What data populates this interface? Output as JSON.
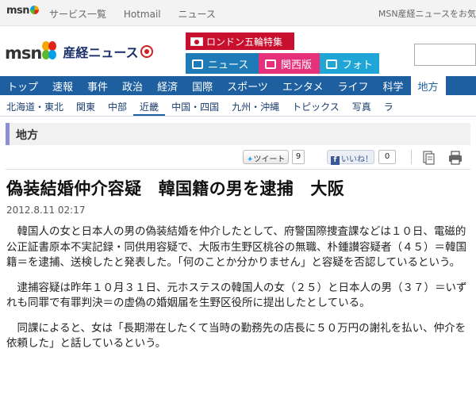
{
  "topbar": {
    "brand": "msn",
    "links": [
      "サービス一覧",
      "Hotmail",
      "ニュース"
    ],
    "right_text": "MSN産経ニュースをお気"
  },
  "header": {
    "logo_msn": "msn",
    "logo_sankei": "産経ニュース",
    "special_label": "ロンドン五輪特集",
    "subtabs": [
      {
        "label": "ニュース",
        "color": "#1e7bb8"
      },
      {
        "label": "関西版",
        "color": "#e5307a"
      },
      {
        "label": "フォト",
        "color": "#1fa6d6"
      }
    ]
  },
  "nav_primary": [
    "トップ",
    "速報",
    "事件",
    "政治",
    "経済",
    "国際",
    "スポーツ",
    "エンタメ",
    "ライフ",
    "科学",
    "地方"
  ],
  "nav_secondary": [
    "北海道・東北",
    "関東",
    "中部",
    "近畿",
    "中国・四国",
    "九州・沖縄",
    "トピックス",
    "写真",
    "ラ"
  ],
  "nav_secondary_active": "近畿",
  "section_title": "地方",
  "share": {
    "tweet_label": "ツイート",
    "tweet_count": "9",
    "like_label": "いいね！",
    "like_count": "0"
  },
  "article": {
    "headline": "偽装結婚仲介容疑　韓国籍の男を逮捕　大阪",
    "date": "2012.8.11 02:17",
    "paragraphs": [
      "韓国人の女と日本人の男の偽装結婚を仲介したとして、府警国際捜査課などは１０日、電磁的公正証書原本不実記録・同供用容疑で、大阪市生野区桃谷の無職、朴鍾讃容疑者（４５）＝韓国籍＝を逮捕、送検したと発表した。「何のことか分かりません」と容疑を否認しているという。",
      "逮捕容疑は昨年１０月３１日、元ホステスの韓国人の女（２５）と日本人の男（３７）＝いずれも同罪で有罪判決＝の虚偽の婚姻届を生野区役所に提出したとしている。",
      "同課によると、女は「長期滞在したくて当時の勤務先の店長に５０万円の謝礼を払い、仲介を依頼した」と話しているという。"
    ]
  },
  "colors": {
    "nav_blue": "#1e5fa0",
    "special_red": "#c8102e",
    "section_accent": "#8a8fd6"
  }
}
